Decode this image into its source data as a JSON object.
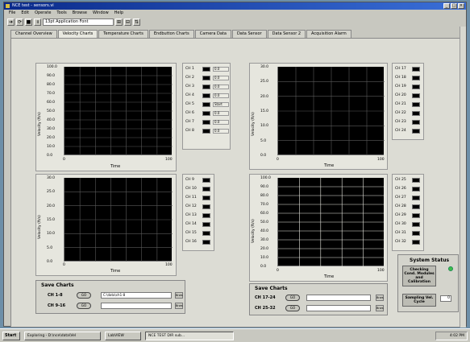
{
  "window": {
    "title": "NCE test - sensors.vi",
    "menu": [
      "File",
      "Edit",
      "Operate",
      "Tools",
      "Browse",
      "Window",
      "Help"
    ],
    "toolbar": {
      "font": "13pt Application Font"
    }
  },
  "tabs": [
    {
      "label": "Channel Overview",
      "active": false
    },
    {
      "label": "Velocity Charts",
      "active": true
    },
    {
      "label": "Temperature Charts",
      "active": false
    },
    {
      "label": "Endbutton Charts",
      "active": false
    },
    {
      "label": "Camera Data",
      "active": false
    },
    {
      "label": "Data Sensor",
      "active": false
    },
    {
      "label": "Data Sensor 2",
      "active": false
    },
    {
      "label": "Acquisition Alarm",
      "active": false
    }
  ],
  "graphs": [
    {
      "id": "g1",
      "ylabel": "Velocity (ft/s)",
      "yticks": [
        "100.0",
        "90.0",
        "80.0",
        "70.0",
        "60.0",
        "50.0",
        "40.0",
        "30.0",
        "20.0",
        "10.0",
        "0.0"
      ],
      "xticks": [
        "0",
        "100"
      ],
      "xlabel": "Time",
      "legend": [
        "CH 1",
        "CH 2",
        "CH 3",
        "CH 4",
        "CH 5",
        "CH 6",
        "CH 7",
        "CH 8"
      ],
      "legend_values": [
        "0.0",
        "0.0",
        "0.0",
        "0.0",
        "Start",
        "0.0",
        "0.0",
        "0.0"
      ]
    },
    {
      "id": "g2",
      "ylabel": "Velocity (ft/s)",
      "yticks": [
        "30.0",
        "25.0",
        "20.0",
        "15.0",
        "10.0",
        "5.0",
        "0.0"
      ],
      "xticks": [
        "0",
        "100"
      ],
      "xlabel": "Time",
      "legend": [
        "CH 9",
        "CH 10",
        "CH 11",
        "CH 12",
        "CH 13",
        "CH 14",
        "CH 15",
        "CH 16"
      ]
    },
    {
      "id": "g3",
      "ylabel": "Velocity (ft/s)",
      "yticks": [
        "30.0",
        "25.0",
        "20.0",
        "15.0",
        "10.0",
        "5.0",
        "0.0"
      ],
      "xticks": [
        "0",
        "100"
      ],
      "xlabel": "Time",
      "legend": [
        "CH 17",
        "CH 18",
        "CH 19",
        "CH 20",
        "CH 21",
        "CH 22",
        "CH 23",
        "CH 24"
      ]
    },
    {
      "id": "g4",
      "ylabel": "Velocity (ft/s)",
      "yticks": [
        "100.0",
        "90.0",
        "80.0",
        "70.0",
        "60.0",
        "50.0",
        "40.0",
        "30.0",
        "20.0",
        "10.0",
        "0.0"
      ],
      "xticks": [
        "0",
        "100"
      ],
      "xlabel": "Time",
      "legend": [
        "CH 25",
        "CH 26",
        "CH 27",
        "CH 28",
        "CH 29",
        "CH 30",
        "CH 31",
        "CH 32"
      ]
    }
  ],
  "save_left": {
    "title": "Save Charts",
    "rows": [
      {
        "label": "CH 1-8",
        "button": "GO",
        "path": "C:\\data\\ch1-8",
        "browse": "Brws"
      },
      {
        "label": "CH 9-16",
        "button": "GO",
        "path": "",
        "browse": "Brws"
      }
    ]
  },
  "save_right": {
    "title": "Save Charts",
    "rows": [
      {
        "label": "CH 17-24",
        "button": "GO",
        "path": "",
        "browse": "Brws"
      },
      {
        "label": "CH 25-32",
        "button": "GO",
        "path": "",
        "browse": "Brws"
      }
    ]
  },
  "system": {
    "title": "System Status",
    "button1": "Checking Cond. Modules and Calibration",
    "button2": "Sampling Vel. Cycle",
    "cycle_value": "0"
  },
  "taskbar": {
    "start": "Start",
    "tasks": [
      {
        "label": "Exploring - D:\\nce\\data\\Vel",
        "active": false
      },
      {
        "label": "LabVIEW",
        "active": false
      },
      {
        "label": "NCE TEST DIR sub...",
        "active": true
      }
    ],
    "clock": "4:02 PM"
  }
}
